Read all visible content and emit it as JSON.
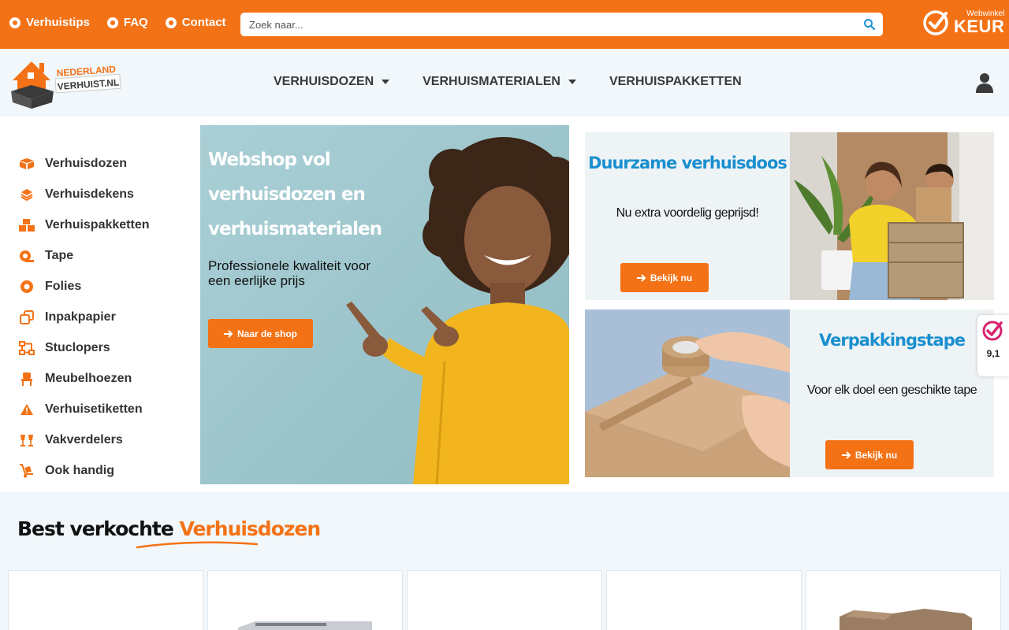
{
  "topbar": {
    "links": [
      "Verhuistips",
      "FAQ",
      "Contact"
    ],
    "search_placeholder": "Zoek naar...",
    "keur_small": "Webwinkel",
    "keur_big": "KEUR"
  },
  "logo": {
    "line1": "NEDERLAND",
    "line2": "VERHUIST.NL"
  },
  "nav": {
    "items": [
      "VERHUISDOZEN",
      "VERHUISMATERIALEN",
      "VERHUISPAKKETTEN"
    ]
  },
  "sidebar": {
    "items": [
      {
        "label": "Verhuisdozen",
        "icon": "box-icon"
      },
      {
        "label": "Verhuisdekens",
        "icon": "layers-icon"
      },
      {
        "label": "Verhuispakketten",
        "icon": "boxes-icon"
      },
      {
        "label": "Tape",
        "icon": "tape-icon"
      },
      {
        "label": "Folies",
        "icon": "circle-icon"
      },
      {
        "label": "Inpakpapier",
        "icon": "copy-icon"
      },
      {
        "label": "Stuclopers",
        "icon": "network-icon"
      },
      {
        "label": "Meubelhoezen",
        "icon": "chair-icon"
      },
      {
        "label": "Verhuisetiketten",
        "icon": "warning-icon"
      },
      {
        "label": "Vakverdelers",
        "icon": "glasses-icon"
      },
      {
        "label": "Ook handig",
        "icon": "dolly-icon"
      }
    ]
  },
  "hero": {
    "title": "Webshop vol verhuisdozen en verhuismaterialen",
    "subtitle": "Professionele kwaliteit voor een eerlijke prijs",
    "button": "Naar de shop"
  },
  "promo1": {
    "title": "Duurzame verhuisdoos",
    "text": "Nu extra voordelig geprijsd!",
    "button": "Bekijk nu"
  },
  "promo2": {
    "title": "Verpakkingstape",
    "text": "Voor elk doel een geschikte tape",
    "button": "Bekijk nu"
  },
  "rating": {
    "value": "9,1"
  },
  "bestsellers": {
    "title_prefix": "Best verkochte",
    "title_highlight": "Verhuisdozen"
  },
  "colors": {
    "accent": "#f47216",
    "blue": "#1a8fcf",
    "light_bg": "#f1f7fa"
  }
}
